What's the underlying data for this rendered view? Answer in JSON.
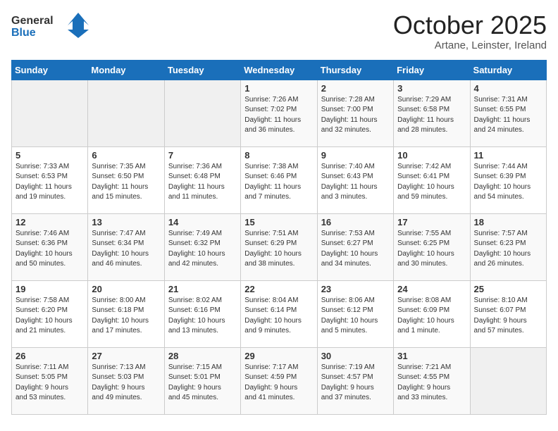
{
  "header": {
    "logo_general": "General",
    "logo_blue": "Blue",
    "title": "October 2025",
    "subtitle": "Artane, Leinster, Ireland"
  },
  "weekdays": [
    "Sunday",
    "Monday",
    "Tuesday",
    "Wednesday",
    "Thursday",
    "Friday",
    "Saturday"
  ],
  "weeks": [
    [
      {
        "day": "",
        "info": ""
      },
      {
        "day": "",
        "info": ""
      },
      {
        "day": "",
        "info": ""
      },
      {
        "day": "1",
        "info": "Sunrise: 7:26 AM\nSunset: 7:02 PM\nDaylight: 11 hours\nand 36 minutes."
      },
      {
        "day": "2",
        "info": "Sunrise: 7:28 AM\nSunset: 7:00 PM\nDaylight: 11 hours\nand 32 minutes."
      },
      {
        "day": "3",
        "info": "Sunrise: 7:29 AM\nSunset: 6:58 PM\nDaylight: 11 hours\nand 28 minutes."
      },
      {
        "day": "4",
        "info": "Sunrise: 7:31 AM\nSunset: 6:55 PM\nDaylight: 11 hours\nand 24 minutes."
      }
    ],
    [
      {
        "day": "5",
        "info": "Sunrise: 7:33 AM\nSunset: 6:53 PM\nDaylight: 11 hours\nand 19 minutes."
      },
      {
        "day": "6",
        "info": "Sunrise: 7:35 AM\nSunset: 6:50 PM\nDaylight: 11 hours\nand 15 minutes."
      },
      {
        "day": "7",
        "info": "Sunrise: 7:36 AM\nSunset: 6:48 PM\nDaylight: 11 hours\nand 11 minutes."
      },
      {
        "day": "8",
        "info": "Sunrise: 7:38 AM\nSunset: 6:46 PM\nDaylight: 11 hours\nand 7 minutes."
      },
      {
        "day": "9",
        "info": "Sunrise: 7:40 AM\nSunset: 6:43 PM\nDaylight: 11 hours\nand 3 minutes."
      },
      {
        "day": "10",
        "info": "Sunrise: 7:42 AM\nSunset: 6:41 PM\nDaylight: 10 hours\nand 59 minutes."
      },
      {
        "day": "11",
        "info": "Sunrise: 7:44 AM\nSunset: 6:39 PM\nDaylight: 10 hours\nand 54 minutes."
      }
    ],
    [
      {
        "day": "12",
        "info": "Sunrise: 7:46 AM\nSunset: 6:36 PM\nDaylight: 10 hours\nand 50 minutes."
      },
      {
        "day": "13",
        "info": "Sunrise: 7:47 AM\nSunset: 6:34 PM\nDaylight: 10 hours\nand 46 minutes."
      },
      {
        "day": "14",
        "info": "Sunrise: 7:49 AM\nSunset: 6:32 PM\nDaylight: 10 hours\nand 42 minutes."
      },
      {
        "day": "15",
        "info": "Sunrise: 7:51 AM\nSunset: 6:29 PM\nDaylight: 10 hours\nand 38 minutes."
      },
      {
        "day": "16",
        "info": "Sunrise: 7:53 AM\nSunset: 6:27 PM\nDaylight: 10 hours\nand 34 minutes."
      },
      {
        "day": "17",
        "info": "Sunrise: 7:55 AM\nSunset: 6:25 PM\nDaylight: 10 hours\nand 30 minutes."
      },
      {
        "day": "18",
        "info": "Sunrise: 7:57 AM\nSunset: 6:23 PM\nDaylight: 10 hours\nand 26 minutes."
      }
    ],
    [
      {
        "day": "19",
        "info": "Sunrise: 7:58 AM\nSunset: 6:20 PM\nDaylight: 10 hours\nand 21 minutes."
      },
      {
        "day": "20",
        "info": "Sunrise: 8:00 AM\nSunset: 6:18 PM\nDaylight: 10 hours\nand 17 minutes."
      },
      {
        "day": "21",
        "info": "Sunrise: 8:02 AM\nSunset: 6:16 PM\nDaylight: 10 hours\nand 13 minutes."
      },
      {
        "day": "22",
        "info": "Sunrise: 8:04 AM\nSunset: 6:14 PM\nDaylight: 10 hours\nand 9 minutes."
      },
      {
        "day": "23",
        "info": "Sunrise: 8:06 AM\nSunset: 6:12 PM\nDaylight: 10 hours\nand 5 minutes."
      },
      {
        "day": "24",
        "info": "Sunrise: 8:08 AM\nSunset: 6:09 PM\nDaylight: 10 hours\nand 1 minute."
      },
      {
        "day": "25",
        "info": "Sunrise: 8:10 AM\nSunset: 6:07 PM\nDaylight: 9 hours\nand 57 minutes."
      }
    ],
    [
      {
        "day": "26",
        "info": "Sunrise: 7:11 AM\nSunset: 5:05 PM\nDaylight: 9 hours\nand 53 minutes."
      },
      {
        "day": "27",
        "info": "Sunrise: 7:13 AM\nSunset: 5:03 PM\nDaylight: 9 hours\nand 49 minutes."
      },
      {
        "day": "28",
        "info": "Sunrise: 7:15 AM\nSunset: 5:01 PM\nDaylight: 9 hours\nand 45 minutes."
      },
      {
        "day": "29",
        "info": "Sunrise: 7:17 AM\nSunset: 4:59 PM\nDaylight: 9 hours\nand 41 minutes."
      },
      {
        "day": "30",
        "info": "Sunrise: 7:19 AM\nSunset: 4:57 PM\nDaylight: 9 hours\nand 37 minutes."
      },
      {
        "day": "31",
        "info": "Sunrise: 7:21 AM\nSunset: 4:55 PM\nDaylight: 9 hours\nand 33 minutes."
      },
      {
        "day": "",
        "info": ""
      }
    ]
  ]
}
